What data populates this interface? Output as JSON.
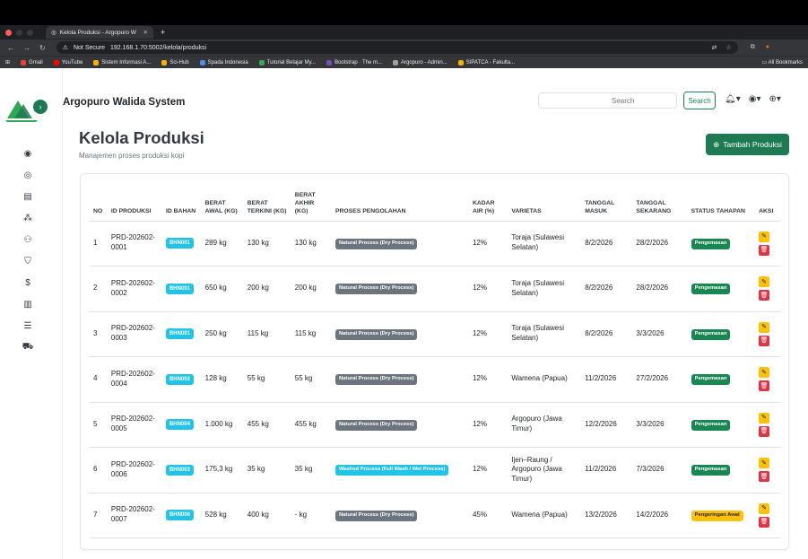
{
  "browser": {
    "tab_title": "Kelola Produksi - Argopuro W",
    "not_secure": "Not Secure",
    "url": "192.168.1.70:5002/kelola/produksi",
    "bookmarks": [
      "Gmail",
      "YouTube",
      "Sistem Informasi A...",
      "Sci-Hub",
      "Spada Indonesia",
      "Tutorial Belajar My...",
      "Bootstrap · The m...",
      "Argopuro - Admin...",
      "SIPATCA - Fakulta..."
    ],
    "all_bookmarks": "All Bookmarks"
  },
  "app": {
    "title": "Argopuro Walida System",
    "search_placeholder": "Search",
    "search_button": "Search"
  },
  "page": {
    "title": "Kelola Produksi",
    "subtitle": "Manajemen proses produksi kopi",
    "add_button": "Tambah Produksi"
  },
  "table": {
    "headers": [
      "NO",
      "ID PRODUKSI",
      "ID BAHAN",
      "BERAT AWAL (KG)",
      "BERAT TERKINI (KG)",
      "BERAT AKHIR (KG)",
      "PROSES PENGOLAHAN",
      "KADAR AIR (%)",
      "VARIETAS",
      "TANGGAL MASUK",
      "TANGGAL SEKARANG",
      "STATUS TAHAPAN",
      "AKSI"
    ],
    "rows": [
      {
        "no": "1",
        "id": "PRD-202602-0001",
        "bahan": "BHN001",
        "awal": "289 kg",
        "terkini": "130 kg",
        "akhir": "130 kg",
        "proses": "Natural Process (Dry Process)",
        "kadar": "12%",
        "varietas": "Toraja (Sulawesi Selatan)",
        "masuk": "8/2/2026",
        "sekarang": "28/2/2026",
        "status": "Pengemasan"
      },
      {
        "no": "2",
        "id": "PRD-202602-0002",
        "bahan": "BHN001",
        "awal": "650 kg",
        "terkini": "200 kg",
        "akhir": "200 kg",
        "proses": "Natural Process (Dry Process)",
        "kadar": "12%",
        "varietas": "Toraja (Sulawesi Selatan)",
        "masuk": "8/2/2026",
        "sekarang": "28/2/2026",
        "status": "Pengemasan"
      },
      {
        "no": "3",
        "id": "PRD-202602-0003",
        "bahan": "BHN001",
        "awal": "250 kg",
        "terkini": "115 kg",
        "akhir": "115 kg",
        "proses": "Natural Process (Dry Process)",
        "kadar": "12%",
        "varietas": "Toraja (Sulawesi Selatan)",
        "masuk": "8/2/2026",
        "sekarang": "3/3/2026",
        "status": "Pengemasan"
      },
      {
        "no": "4",
        "id": "PRD-202602-0004",
        "bahan": "BHN002",
        "awal": "128 kg",
        "terkini": "55 kg",
        "akhir": "55 kg",
        "proses": "Natural Process (Dry Process)",
        "kadar": "12%",
        "varietas": "Wamena (Papua)",
        "masuk": "11/2/2026",
        "sekarang": "27/2/2026",
        "status": "Pengemasan"
      },
      {
        "no": "5",
        "id": "PRD-202602-0005",
        "bahan": "BHN004",
        "awal": "1.000 kg",
        "terkini": "455 kg",
        "akhir": "455 kg",
        "proses": "Natural Process (Dry Process)",
        "kadar": "12%",
        "varietas": "Argopuro (Jawa Timur)",
        "masuk": "12/2/2026",
        "sekarang": "3/3/2026",
        "status": "Pengemasan"
      },
      {
        "no": "6",
        "id": "PRD-202602-0006",
        "bahan": "BHN003",
        "awal": "175,3 kg",
        "terkini": "35 kg",
        "akhir": "35 kg",
        "proses": "Washed Process (Full Wash / Wet Process)",
        "kadar": "12%",
        "varietas": "Ijen–Raung / Argopuro (Jawa Timur)",
        "masuk": "11/2/2026",
        "sekarang": "7/3/2026",
        "status": "Pengemasan"
      },
      {
        "no": "7",
        "id": "PRD-202602-0007",
        "bahan": "BHN006",
        "awal": "528 kg",
        "terkini": "400 kg",
        "akhir": "- kg",
        "proses": "Natural Process (Dry Process)",
        "kadar": "45%",
        "varietas": "Wamena (Papua)",
        "masuk": "13/2/2026",
        "sekarang": "14/2/2026",
        "status": "Pengeringan Awal"
      }
    ]
  },
  "colors": {
    "primary_green": "#1e7a52",
    "badge_cyan": "#22c3e6",
    "badge_gray": "#6c757d",
    "status_green": "#198754",
    "status_yellow": "#ffc107",
    "danger": "#dc3545"
  }
}
